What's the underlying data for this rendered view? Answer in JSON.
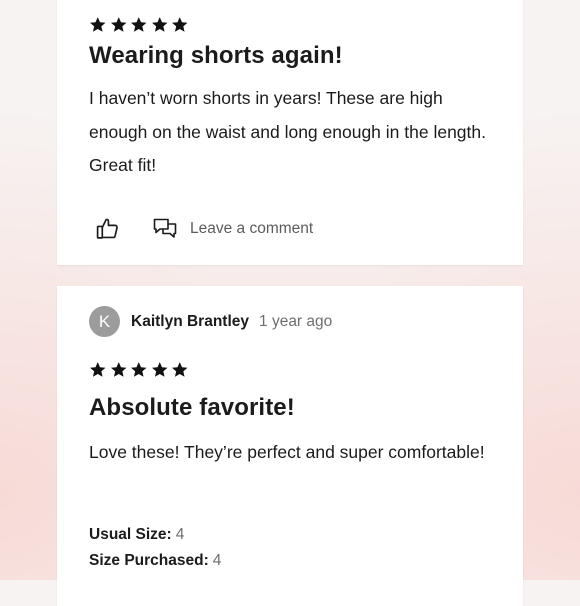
{
  "reviews": [
    {
      "rating": 5,
      "title": "Wearing shorts again!",
      "body": "I haven’t worn shorts in years! These are high enough on the waist and long enough in the length. Great fit!",
      "actions": {
        "helpful_icon": "thumbs-up-icon",
        "comment_icon": "chat-bubbles-icon",
        "comment_label": "Leave a comment"
      }
    },
    {
      "author": {
        "initial": "K",
        "name": "Kaitlyn Brantley",
        "date": "1 year ago"
      },
      "rating": 5,
      "title": "Absolute favorite!",
      "body": "Love these! They’re perfect and super comfortable!",
      "details": {
        "usual_size_label": "Usual Size:",
        "usual_size_value": "4",
        "size_purchased_label": "Size Purchased:",
        "size_purchased_value": "4"
      }
    }
  ],
  "colors": {
    "star": "#111111",
    "avatar": "#9c9c9c",
    "muted_text": "#6e6e6e"
  }
}
